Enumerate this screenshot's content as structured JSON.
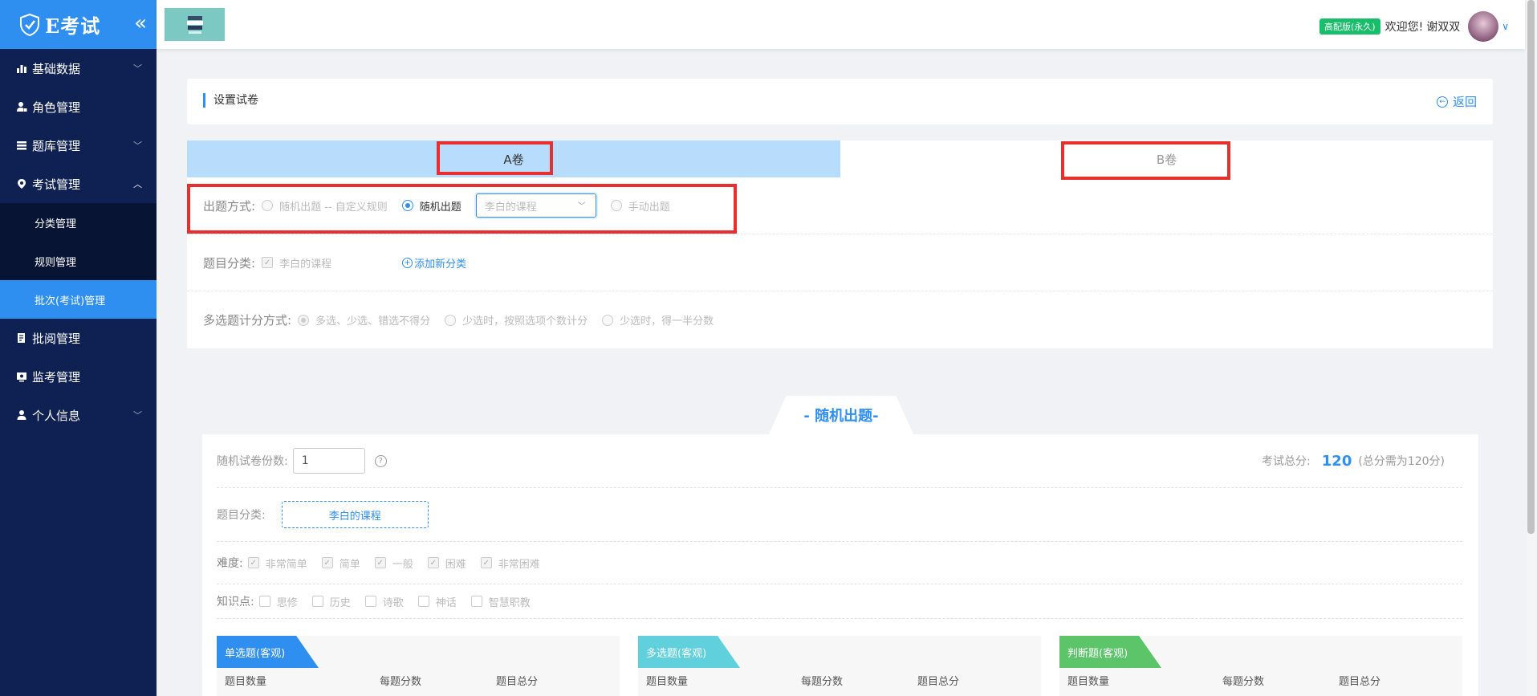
{
  "app": {
    "logo_text": "E考试",
    "collapse_icon": "double-chevron-left-icon"
  },
  "sidebar": {
    "items": [
      {
        "label": "基础数据",
        "icon": "bar-chart-icon",
        "chevron": "﹀"
      },
      {
        "label": "角色管理",
        "icon": "user-lock-icon"
      },
      {
        "label": "题库管理",
        "icon": "list-icon",
        "chevron": "﹀"
      },
      {
        "label": "考试管理",
        "icon": "map-pin-icon",
        "chevron": "︿"
      },
      {
        "label": "批阅管理",
        "icon": "edit-icon"
      },
      {
        "label": "监考管理",
        "icon": "monitor-icon"
      },
      {
        "label": "个人信息",
        "icon": "user-icon",
        "chevron": "﹀"
      }
    ],
    "submenu": [
      {
        "label": "分类管理"
      },
      {
        "label": "规则管理"
      },
      {
        "label": "批次(考试)管理"
      }
    ]
  },
  "topbar": {
    "edition_badge": "高配版(永久)",
    "welcome": "欢迎您!",
    "username": "谢双双",
    "user_chevron": "∨"
  },
  "header": {
    "title": "设置试卷",
    "back_label": "返回"
  },
  "tabs": {
    "a": "A卷",
    "b": "B卷"
  },
  "form": {
    "method": {
      "label": "出题方式:",
      "options": [
        "随机出题 -- 自定义规则",
        "随机出题",
        "手动出题"
      ],
      "selected_index": 1,
      "course_select": "李白的课程"
    },
    "category": {
      "label": "题目分类:",
      "course": "李白的课程",
      "add_label": "添加新分类"
    },
    "multi_scoring": {
      "label": "多选题计分方式:",
      "options": [
        "多选、少选、错选不得分",
        "少选时，按照选项个数计分",
        "少选时，得一半分数"
      ],
      "selected_index": 0
    }
  },
  "random": {
    "title": "- 随机出题-",
    "copies_label": "随机试卷份数:",
    "copies_value": "1",
    "total_label": "考试总分:",
    "total_value": "120",
    "total_note": "(总分需为120分)",
    "category_label": "题目分类:",
    "category_value": "李白的课程",
    "difficulty_label": "难度:",
    "difficulties": [
      "非常简单",
      "简单",
      "一般",
      "困难",
      "非常困难"
    ],
    "knowledge_label": "知识点:",
    "knowledge_points": [
      "思修",
      "历史",
      "诗歌",
      "神话",
      "智慧职教"
    ],
    "question_types": [
      {
        "name": "单选题(客观)",
        "color": "#2f8ff0"
      },
      {
        "name": "多选题(客观)",
        "color": "#5fd0dc"
      },
      {
        "name": "判断题(客观)",
        "color": "#5cc56a"
      }
    ],
    "columns": [
      "题目数量",
      "每题分数",
      "题目总分"
    ]
  }
}
